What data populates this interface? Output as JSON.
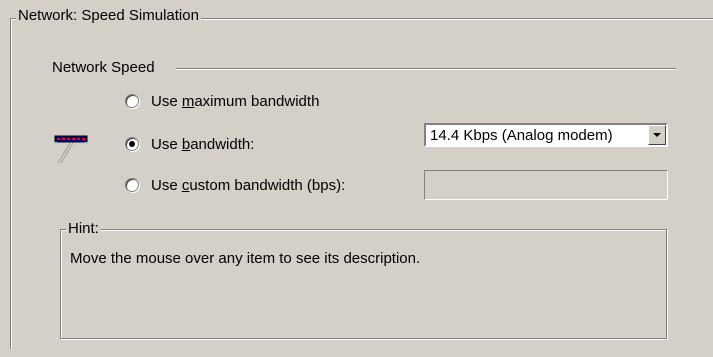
{
  "outer_group": {
    "title": "Network: Speed Simulation"
  },
  "network_speed": {
    "label": "Network Speed",
    "icon": "network-card-icon",
    "options": [
      {
        "pre": "Use ",
        "accel": "m",
        "post": "aximum bandwidth",
        "checked": false
      },
      {
        "pre": "Use ",
        "accel": "b",
        "post": "andwidth:",
        "checked": true
      },
      {
        "pre": "Use ",
        "accel": "c",
        "post": "ustom bandwidth (bps):",
        "checked": false
      }
    ],
    "bandwidth_select": {
      "value": "14.4 Kbps (Analog modem)"
    },
    "custom_bandwidth_input": {
      "value": ""
    }
  },
  "hint": {
    "title": "Hint:",
    "text": "Move the mouse over any item to see its description."
  }
}
